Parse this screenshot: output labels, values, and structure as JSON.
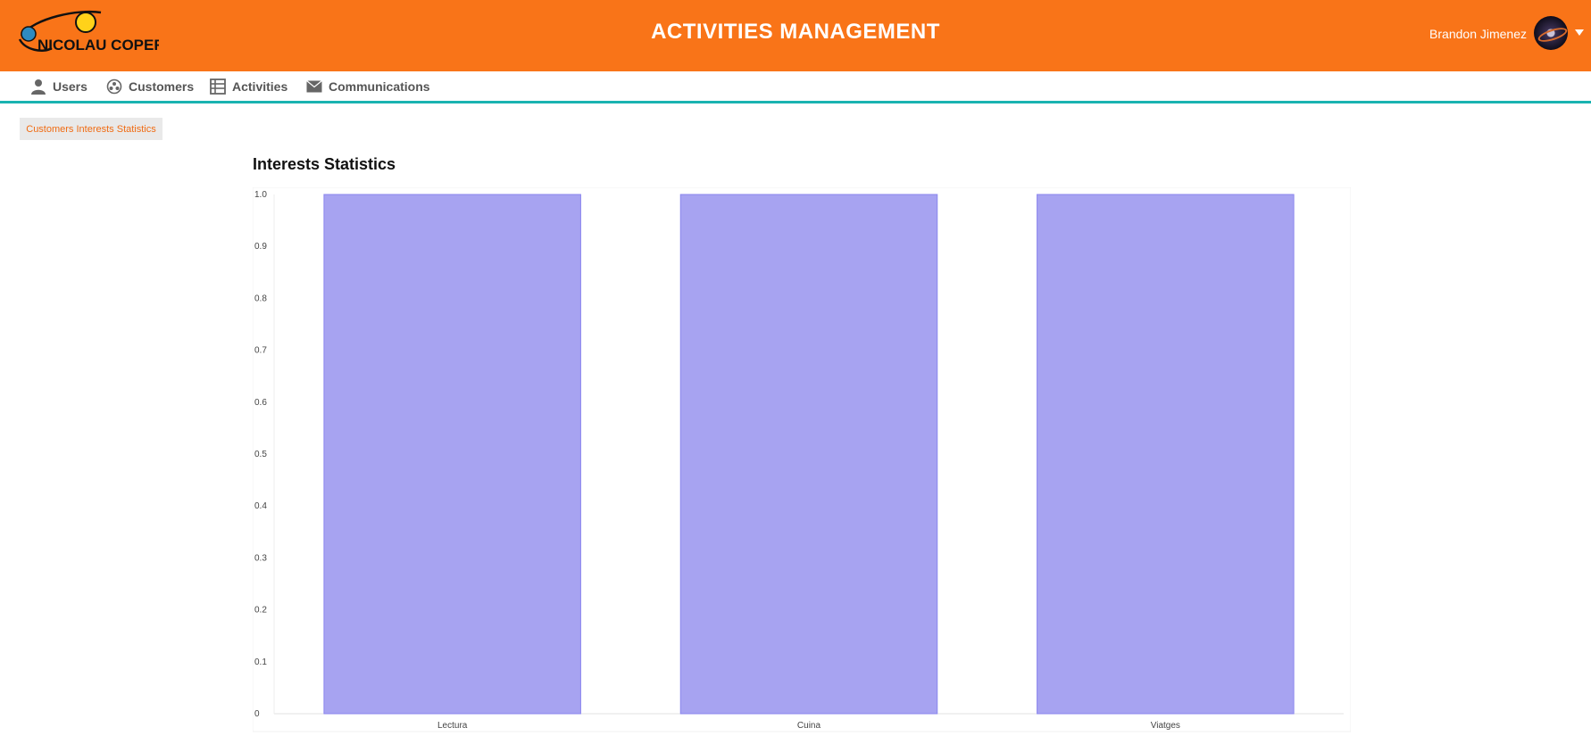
{
  "app": {
    "title": "ACTIVITIES MANAGEMENT",
    "logo_text": "INSTITUT NICOLAU COPERNIC TERRASSA",
    "brand_color": "#f97418",
    "accent_color": "#19b3b1"
  },
  "user": {
    "name": "Brandon Jimenez"
  },
  "nav": {
    "items": [
      {
        "label": "Users",
        "icon": "user-icon"
      },
      {
        "label": "Customers",
        "icon": "customers-icon"
      },
      {
        "label": "Activities",
        "icon": "table-icon"
      },
      {
        "label": "Communications",
        "icon": "envelope-icon"
      }
    ]
  },
  "breadcrumb": {
    "label": "Customers Interests Statistics"
  },
  "chart_section": {
    "title": "Interests Statistics"
  },
  "chart_data": {
    "type": "bar",
    "categories": [
      "Lectura",
      "Cuina",
      "Viatges"
    ],
    "values": [
      1,
      1,
      1
    ],
    "ylim": [
      0,
      1
    ],
    "yticks": [
      "0",
      "0.1",
      "0.2",
      "0.3",
      "0.4",
      "0.5",
      "0.6",
      "0.7",
      "0.8",
      "0.9",
      "1.0"
    ],
    "bar_color": "#a7a3f1",
    "bar_border_color": "#8b86ee",
    "grid": false
  }
}
